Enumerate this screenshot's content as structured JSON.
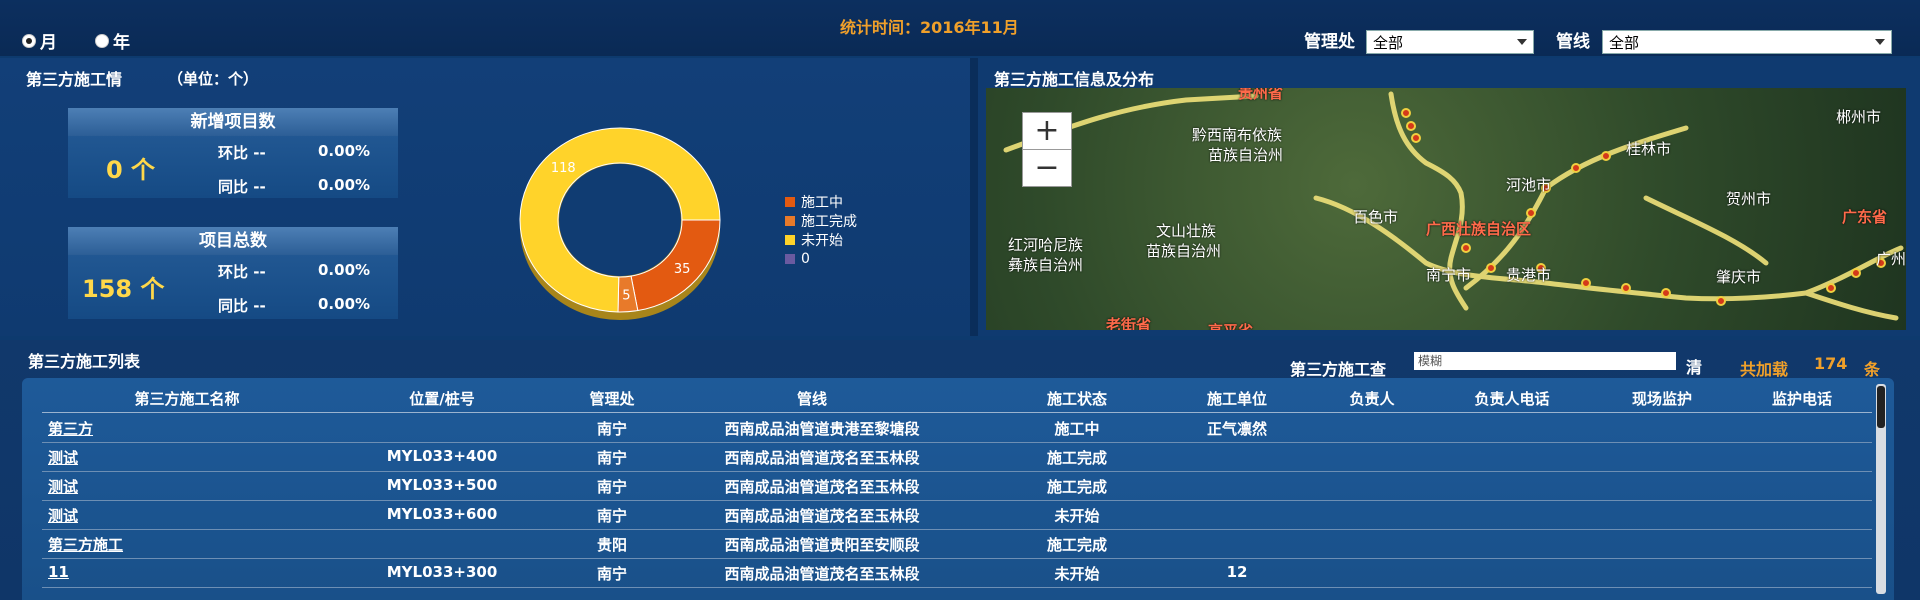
{
  "top": {
    "period_options": [
      {
        "label": "月",
        "selected": true
      },
      {
        "label": "年",
        "selected": false
      }
    ],
    "stat_time": "统计时间：2016年11月",
    "filters": {
      "mgmt_label": "管理处",
      "mgmt_value": "全部",
      "pipeline_label": "管线",
      "pipeline_value": "全部"
    }
  },
  "stats": {
    "title": "第三方施工情",
    "unit": "（单位：个）",
    "new_projects": {
      "title": "新增项目数",
      "value": "0 个",
      "mom_label": "环比 --",
      "mom_value": "0.00%",
      "yoy_label": "同比 --",
      "yoy_value": "0.00%"
    },
    "total_projects": {
      "title": "项目总数",
      "value": "158 个",
      "mom_label": "环比 --",
      "mom_value": "0.00%",
      "yoy_label": "同比 --",
      "yoy_value": "0.00%"
    }
  },
  "chart_data": {
    "type": "pie",
    "title": "",
    "categories": [
      "施工中",
      "施工完成",
      "未开始",
      "0"
    ],
    "values": [
      35,
      5,
      118,
      0
    ],
    "colors": [
      "#e35a11",
      "#e87a2a",
      "#ffd32a",
      "#6a5aa0"
    ],
    "data_labels": [
      "35",
      "5",
      "118",
      ""
    ],
    "donut": true,
    "legend": "right"
  },
  "map": {
    "title": "第三方施工信息及分布",
    "zoom_in": "+",
    "zoom_out": "−",
    "labels": [
      "贵州省",
      "黔西南布依族",
      "苗族自治州",
      "郴州市",
      "桂林市",
      "河池市",
      "贺州市",
      "百色市",
      "广西壮族自治区",
      "广东省",
      "红河哈尼族",
      "彝族自治州",
      "文山壮族",
      "苗族自治州",
      "南宁市",
      "贵港市",
      "肇庆市",
      "广州",
      "老街省",
      "高平省"
    ]
  },
  "list": {
    "title": "第三方施工列表",
    "search_label": "第三方施工查",
    "search_placeholder": "模糊",
    "clear_label": "清",
    "total_prefix": "共加载",
    "total_count": "174",
    "total_suffix": "条",
    "columns": [
      "第三方施工名称",
      "位置/桩号",
      "管理处",
      "管线",
      "施工状态",
      "施工单位",
      "负责人",
      "负责人电话",
      "现场监护",
      "监护电话"
    ],
    "rows": [
      [
        "第三方",
        "",
        "南宁",
        "西南成品油管道贵港至黎塘段",
        "施工中",
        "正气凛然",
        "",
        "",
        "",
        ""
      ],
      [
        "测试",
        "MYL033+400",
        "南宁",
        "西南成品油管道茂名至玉林段",
        "施工完成",
        "",
        "",
        "",
        "",
        ""
      ],
      [
        "测试",
        "MYL033+500",
        "南宁",
        "西南成品油管道茂名至玉林段",
        "施工完成",
        "",
        "",
        "",
        "",
        ""
      ],
      [
        "测试",
        "MYL033+600",
        "南宁",
        "西南成品油管道茂名至玉林段",
        "未开始",
        "",
        "",
        "",
        "",
        ""
      ],
      [
        "第三方施工",
        "",
        "贵阳",
        "西南成品油管道贵阳至安顺段",
        "施工完成",
        "",
        "",
        "",
        "",
        ""
      ],
      [
        "11",
        "MYL033+300",
        "南宁",
        "西南成品油管道茂名至玉林段",
        "未开始",
        "12",
        "",
        "",
        "",
        ""
      ]
    ]
  }
}
